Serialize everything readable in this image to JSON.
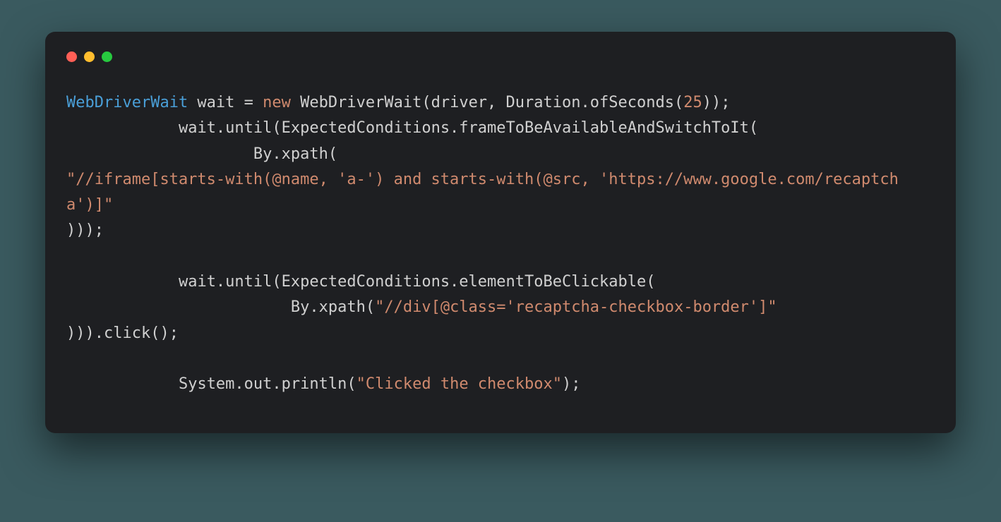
{
  "window": {
    "controls": {
      "close": "close",
      "minimize": "minimize",
      "maximize": "maximize"
    }
  },
  "code": {
    "tokens": [
      {
        "cls": "tk-type",
        "text": "WebDriverWait"
      },
      {
        "cls": "tk-default",
        "text": " wait = "
      },
      {
        "cls": "tk-keyword",
        "text": "new"
      },
      {
        "cls": "tk-default",
        "text": " WebDriverWait(driver, Duration.ofSeconds("
      },
      {
        "cls": "tk-number",
        "text": "25"
      },
      {
        "cls": "tk-default",
        "text": "));\n            wait.until(ExpectedConditions.frameToBeAvailableAndSwitchToIt(\n                    By.xpath(\n"
      },
      {
        "cls": "tk-string",
        "text": "\"//iframe[starts-with(@name, 'a-') and starts-with(@src, 'https://www.google.com/recaptcha')]\""
      },
      {
        "cls": "tk-default",
        "text": "\n)));\n\n            wait.until(ExpectedConditions.elementToBeClickable(\n                        By.xpath("
      },
      {
        "cls": "tk-string",
        "text": "\"//div[@class='recaptcha-checkbox-border']\""
      },
      {
        "cls": "tk-default",
        "text": "\n))).click();\n\n            System.out.println("
      },
      {
        "cls": "tk-string",
        "text": "\"Clicked the checkbox\""
      },
      {
        "cls": "tk-default",
        "text": ");"
      }
    ]
  }
}
